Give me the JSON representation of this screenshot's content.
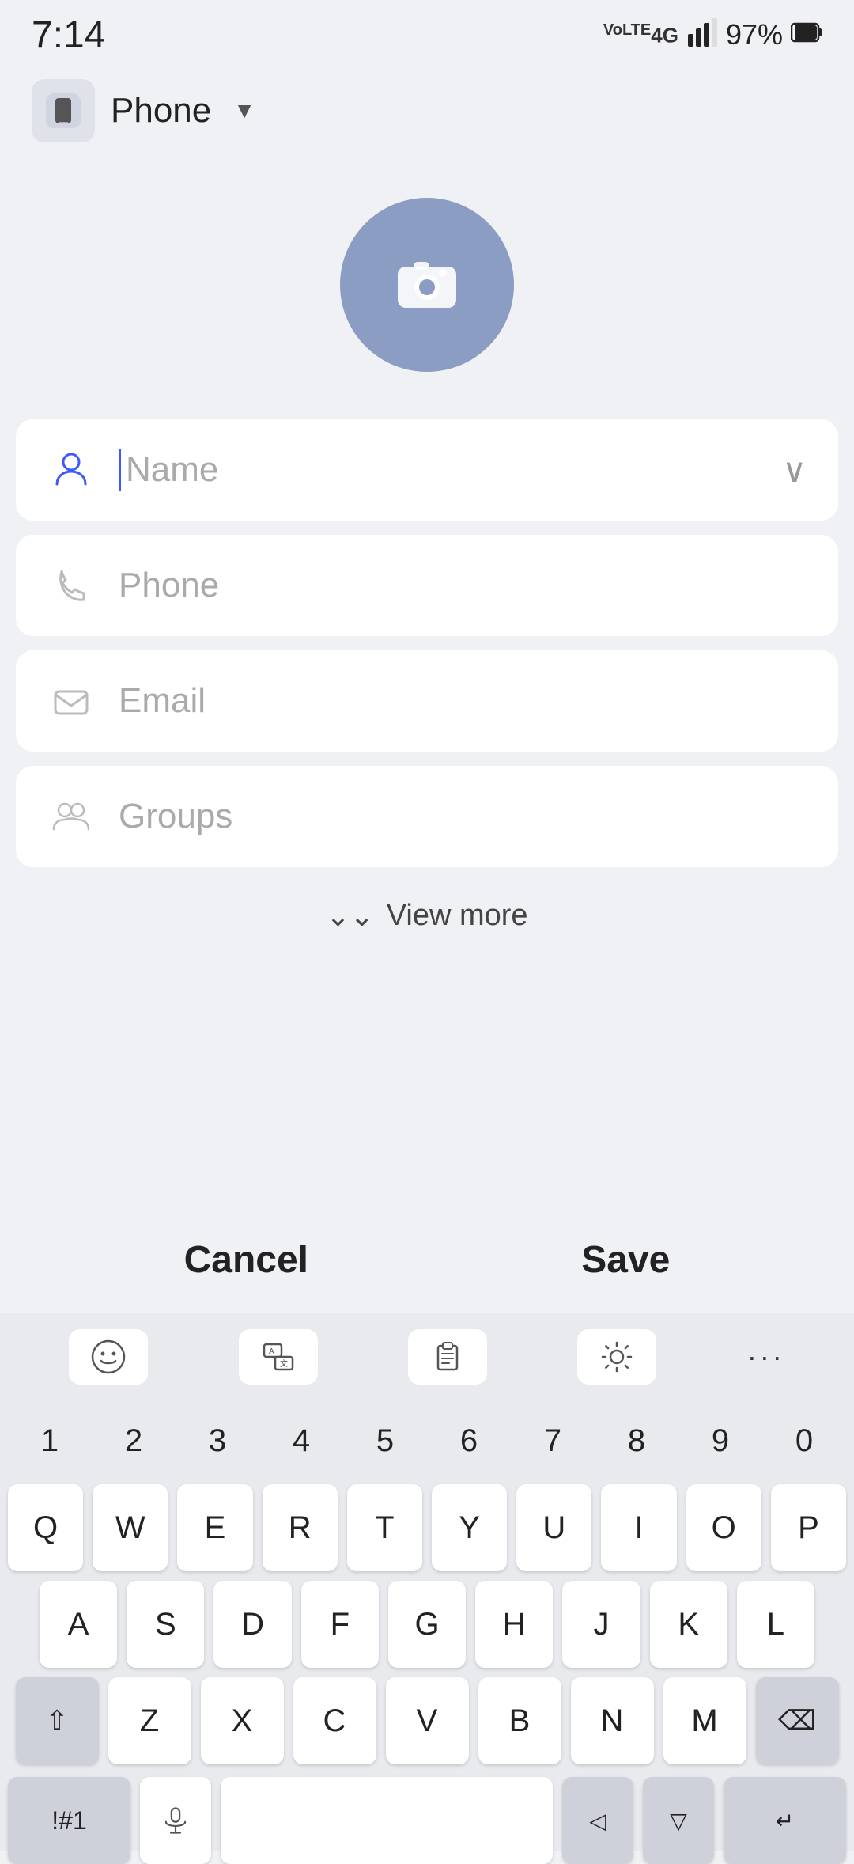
{
  "statusBar": {
    "time": "7:14",
    "network": "VoLTE 4G",
    "signal": "▲",
    "battery": "97%"
  },
  "topBar": {
    "label": "Phone",
    "dropdownArrow": "▼"
  },
  "avatar": {
    "alt": "Add photo"
  },
  "fields": [
    {
      "id": "name",
      "placeholder": "Name",
      "icon": "person-icon",
      "hasChevron": true
    },
    {
      "id": "phone",
      "placeholder": "Phone",
      "icon": "phone-icon",
      "hasChevron": false
    },
    {
      "id": "email",
      "placeholder": "Email",
      "icon": "email-icon",
      "hasChevron": false
    },
    {
      "id": "groups",
      "placeholder": "Groups",
      "icon": "groups-icon",
      "hasChevron": false
    }
  ],
  "viewMore": {
    "label": "View more",
    "arrow": "⌄"
  },
  "actions": {
    "cancel": "Cancel",
    "save": "Save"
  },
  "keyboard": {
    "numRow": [
      "1",
      "2",
      "3",
      "4",
      "5",
      "6",
      "7",
      "8",
      "9",
      "0"
    ],
    "rows": [
      [
        "Q",
        "W",
        "E",
        "R",
        "T",
        "Y",
        "U",
        "I",
        "O",
        "P"
      ],
      [
        "A",
        "S",
        "D",
        "F",
        "G",
        "H",
        "J",
        "K",
        "L"
      ],
      [
        "⇧",
        "Z",
        "X",
        "C",
        "V",
        "B",
        "N",
        "M",
        "⌫"
      ]
    ],
    "bottomRow": [
      "!#1",
      " ",
      "↵"
    ],
    "toolbar": [
      "emoji",
      "translate",
      "clipboard",
      "settings",
      "more"
    ]
  }
}
